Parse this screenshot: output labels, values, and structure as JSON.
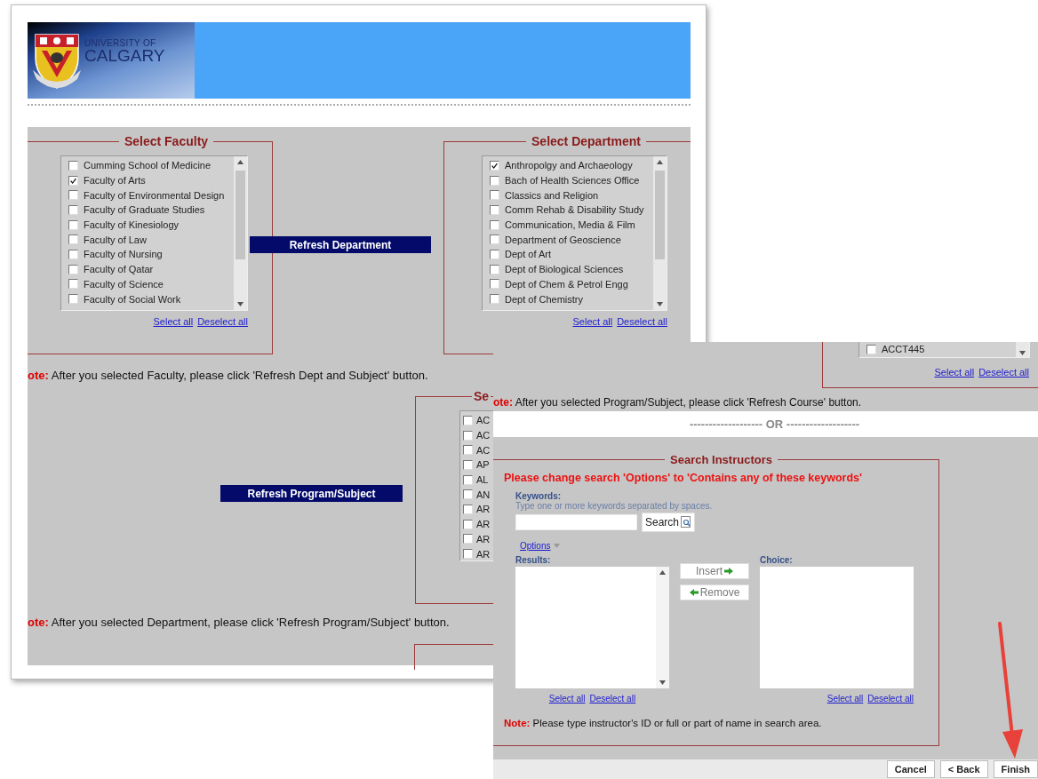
{
  "header": {
    "logo_lines": [
      "UNIVERSITY OF",
      "CALGARY"
    ]
  },
  "faculty": {
    "title": "Select Faculty",
    "items": [
      {
        "label": "Cumming School of Medicine",
        "checked": false
      },
      {
        "label": "Faculty of Arts",
        "checked": true
      },
      {
        "label": "Faculty of Environmental Design",
        "checked": false
      },
      {
        "label": "Faculty of Graduate Studies",
        "checked": false
      },
      {
        "label": "Faculty of Kinesiology",
        "checked": false
      },
      {
        "label": "Faculty of Law",
        "checked": false
      },
      {
        "label": "Faculty of Nursing",
        "checked": false
      },
      {
        "label": "Faculty of Qatar",
        "checked": false
      },
      {
        "label": "Faculty of Science",
        "checked": false
      },
      {
        "label": "Faculty of Social Work",
        "checked": false
      }
    ],
    "links": [
      "Select all",
      "Deselect all"
    ]
  },
  "refresh_department": "Refresh Department",
  "department": {
    "title": "Select Department",
    "items": [
      {
        "label": "Anthropolgy and Archaeology",
        "checked": true
      },
      {
        "label": "Bach of Health Sciences Office",
        "checked": false
      },
      {
        "label": "Classics and Religion",
        "checked": false
      },
      {
        "label": "Comm Rehab & Disability Study",
        "checked": false
      },
      {
        "label": "Communication, Media & Film",
        "checked": false
      },
      {
        "label": "Department of Geoscience",
        "checked": false
      },
      {
        "label": "Dept of Art",
        "checked": false
      },
      {
        "label": "Dept of Biological Sciences",
        "checked": false
      },
      {
        "label": "Dept of Chem & Petrol Engg",
        "checked": false
      },
      {
        "label": "Dept of Chemistry",
        "checked": false
      }
    ],
    "links": [
      "Select all",
      "Deselect all"
    ]
  },
  "note_faculty": "**ote:** After you selected Faculty, please click 'Refresh Dept and Subject' button.",
  "refresh_program": "Refresh Program/Subject",
  "program": {
    "title": "Se",
    "items": [
      {
        "label": "AC",
        "checked": false
      },
      {
        "label": "AC",
        "checked": false
      },
      {
        "label": "AC",
        "checked": false
      },
      {
        "label": "AP",
        "checked": false
      },
      {
        "label": "AL",
        "checked": false
      },
      {
        "label": "AN",
        "checked": false
      },
      {
        "label": "AR",
        "checked": false
      },
      {
        "label": "AR",
        "checked": false
      },
      {
        "label": "AR",
        "checked": false
      },
      {
        "label": "AR",
        "checked": false
      }
    ]
  },
  "note_department": "**ote:** After you selected Department, please click 'Refresh Program/Subject' button.",
  "course": {
    "items": [
      {
        "label": "ACCT445",
        "checked": false
      }
    ],
    "links": [
      "Select all",
      "Deselect all"
    ]
  },
  "note_program": "**ote:** After you selected Program/Subject, please click 'Refresh Course' button.",
  "separator": "------------------- OR -------------------",
  "instructors": {
    "title": "Search Instructors",
    "warning": "Please change search 'Options' to 'Contains any of these keywords'",
    "keywords_label": "Keywords:",
    "keywords_hint": "Type one or more keywords separated by spaces.",
    "search_button": "Search",
    "options_link": "Options",
    "results_label": "Results:",
    "choice_label": "Choice:",
    "insert_button": "Insert",
    "remove_button": "Remove",
    "results_links": [
      "Select all",
      "Deselect all"
    ],
    "choice_links": [
      "Select all",
      "Deselect all"
    ],
    "note": "**Note:** Please type instructor's ID or full or part of name in search area."
  },
  "footer_buttons": [
    "Cancel",
    "< Back",
    "Finish"
  ]
}
